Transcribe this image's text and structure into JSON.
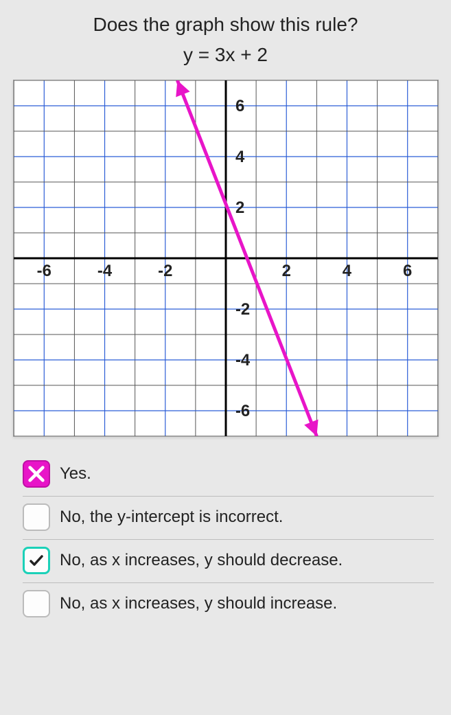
{
  "question": "Does the graph show this rule?",
  "equation": "y = 3x + 2",
  "chart_data": {
    "type": "line",
    "title": "",
    "xlabel": "",
    "ylabel": "",
    "xlim": [
      -7,
      7
    ],
    "ylim": [
      -7,
      7
    ],
    "x_ticks": [
      -6,
      -4,
      -2,
      2,
      4,
      6
    ],
    "y_ticks": [
      -6,
      -4,
      -2,
      2,
      4,
      6
    ],
    "series": [
      {
        "name": "plotted-line",
        "x": [
          -1.6,
          3
        ],
        "y": [
          7,
          -7
        ],
        "color": "#e815c8",
        "arrows": "both"
      }
    ],
    "grid": true,
    "major_grid_every": 2
  },
  "options": [
    {
      "label": "Yes.",
      "state": "wrong"
    },
    {
      "label": "No, the y-intercept is incorrect.",
      "state": "empty"
    },
    {
      "label": "No, as x increases, y should decrease.",
      "state": "correct"
    },
    {
      "label": "No, as x increases, y should increase.",
      "state": "empty"
    }
  ]
}
